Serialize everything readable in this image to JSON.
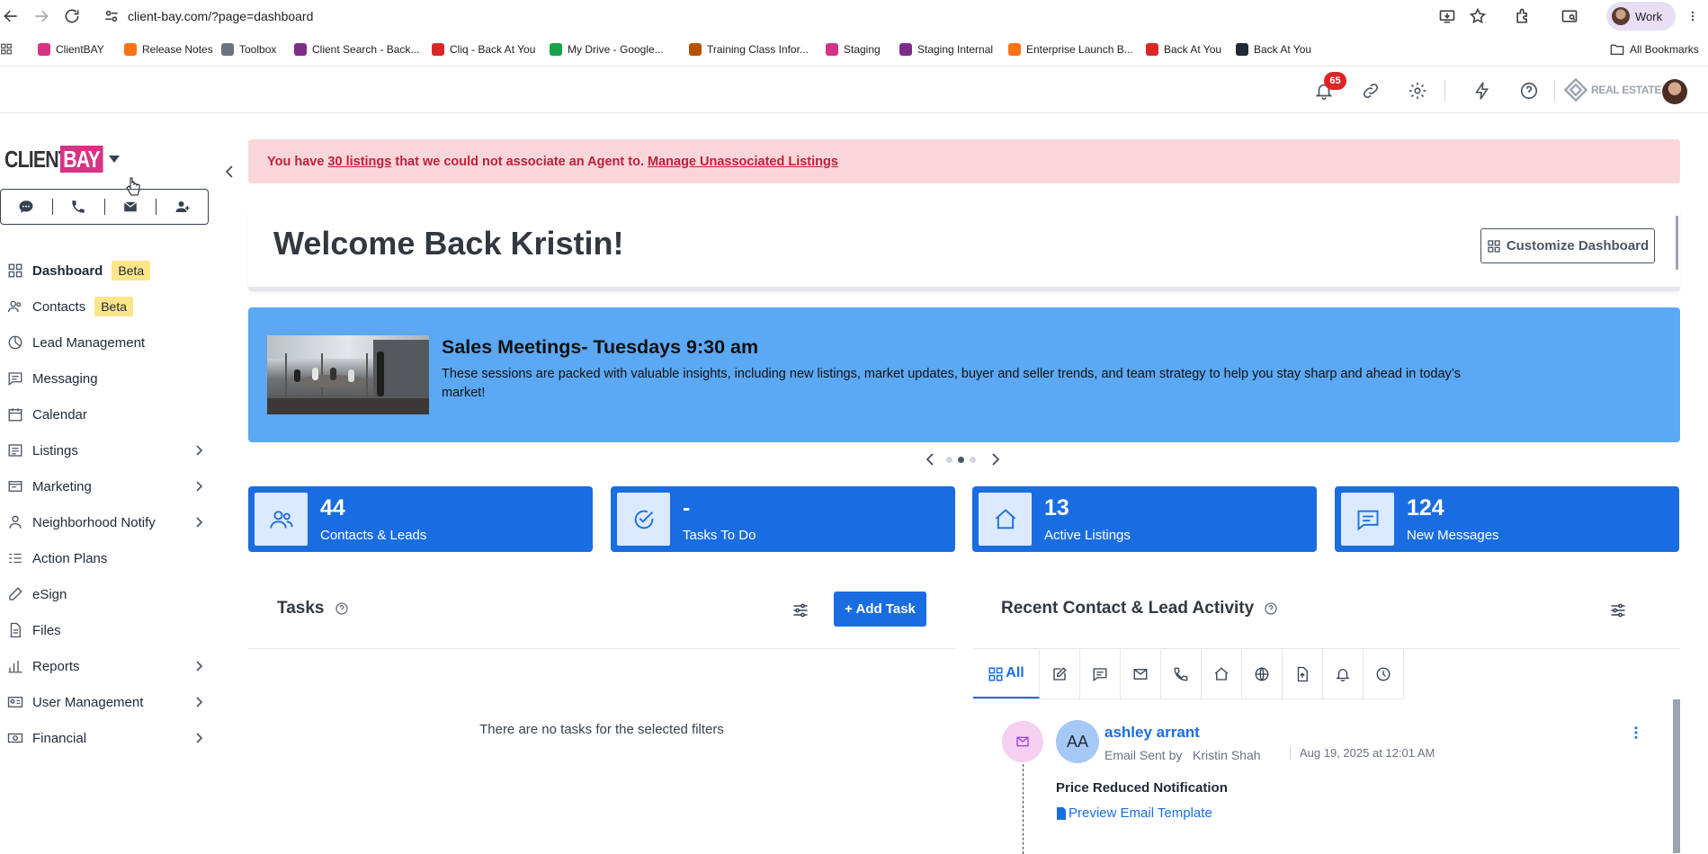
{
  "browser": {
    "url": "client-bay.com/?page=dashboard",
    "profile_label": "Work",
    "bookmarks": [
      {
        "label": "ClientBAY",
        "color": "#d63384"
      },
      {
        "label": "Release Notes",
        "color": "#f97316"
      },
      {
        "label": "Toolbox",
        "color": "#6b7280"
      },
      {
        "label": "Client Search - Back...",
        "color": "#7c2d8a"
      },
      {
        "label": "Cliq - Back At You",
        "color": "#dc2626"
      },
      {
        "label": "My Drive - Google...",
        "color": "#16a34a"
      },
      {
        "label": "Training Class Infor...",
        "color": "#b45309"
      },
      {
        "label": "Staging",
        "color": "#d63384"
      },
      {
        "label": "Staging Internal",
        "color": "#7c2d8a"
      },
      {
        "label": "Enterprise Launch B...",
        "color": "#f97316"
      },
      {
        "label": "Back At You",
        "color": "#dc2626"
      },
      {
        "label": "Back At You",
        "color": "#1f2937"
      }
    ],
    "all_bookmarks_label": "All Bookmarks"
  },
  "header": {
    "notification_count": "65",
    "brand_text": "REAL ESTATE"
  },
  "logo": {
    "client": "CLIENT",
    "bay": "BAY"
  },
  "sidebar": {
    "items": [
      {
        "label": "Dashboard",
        "badge": "Beta",
        "icon": "grid-icon"
      },
      {
        "label": "Contacts",
        "badge": "Beta",
        "icon": "contacts-icon"
      },
      {
        "label": "Lead Management",
        "badge": "",
        "icon": "lead-icon"
      },
      {
        "label": "Messaging",
        "badge": "",
        "icon": "message-icon"
      },
      {
        "label": "Calendar",
        "badge": "",
        "icon": "calendar-icon"
      },
      {
        "label": "Listings",
        "badge": "",
        "icon": "listings-icon"
      },
      {
        "label": "Marketing",
        "badge": "",
        "icon": "marketing-icon"
      },
      {
        "label": "Neighborhood Notify",
        "badge": "",
        "icon": "person-icon"
      },
      {
        "label": "Action Plans",
        "badge": "",
        "icon": "action-plans-icon"
      },
      {
        "label": "eSign",
        "badge": "",
        "icon": "pen-icon"
      },
      {
        "label": "Files",
        "badge": "",
        "icon": "file-icon"
      },
      {
        "label": "Reports",
        "badge": "",
        "icon": "reports-icon"
      },
      {
        "label": "User Management",
        "badge": "",
        "icon": "user-management-icon"
      },
      {
        "label": "Financial",
        "badge": "",
        "icon": "financial-icon"
      }
    ]
  },
  "alert": {
    "prefix": "You have",
    "link": "30 listings",
    "middle": "that we could not associate an Agent to.",
    "action": "Manage Unassociated Listings"
  },
  "welcome": {
    "title": "Welcome Back Kristin!",
    "customize_label": "Customize Dashboard"
  },
  "banner": {
    "title": "Sales Meetings- Tuesdays 9:30 am",
    "body": "These sessions are packed with valuable insights, including new listings, market updates, buyer and seller trends, and team strategy to help you stay sharp and ahead in today’s market!"
  },
  "stats": [
    {
      "value": "44",
      "label": "Contacts & Leads"
    },
    {
      "value": "-",
      "label": "Tasks To Do"
    },
    {
      "value": "13",
      "label": "Active Listings"
    },
    {
      "value": "124",
      "label": "New Messages"
    }
  ],
  "tasks": {
    "title": "Tasks",
    "add_label": "+ Add Task",
    "empty": "There are no tasks for the selected filters"
  },
  "activity": {
    "title": "Recent Contact & Lead Activity",
    "all_tab": "All",
    "item": {
      "initials": "AA",
      "name": "ashley arrant",
      "meta": "Email Sent by",
      "by": "Kristin Shah",
      "date": "Aug 19, 2025 at 12:01 AM",
      "subject": "Price Reduced Notification",
      "link": "Preview Email Template"
    }
  },
  "colors": {
    "accent": "#1a6de0",
    "alert_bg": "#f9d6da",
    "alert_text": "#c0203c",
    "banner_bg": "#5ba8f5",
    "brand_pink": "#d63384"
  }
}
